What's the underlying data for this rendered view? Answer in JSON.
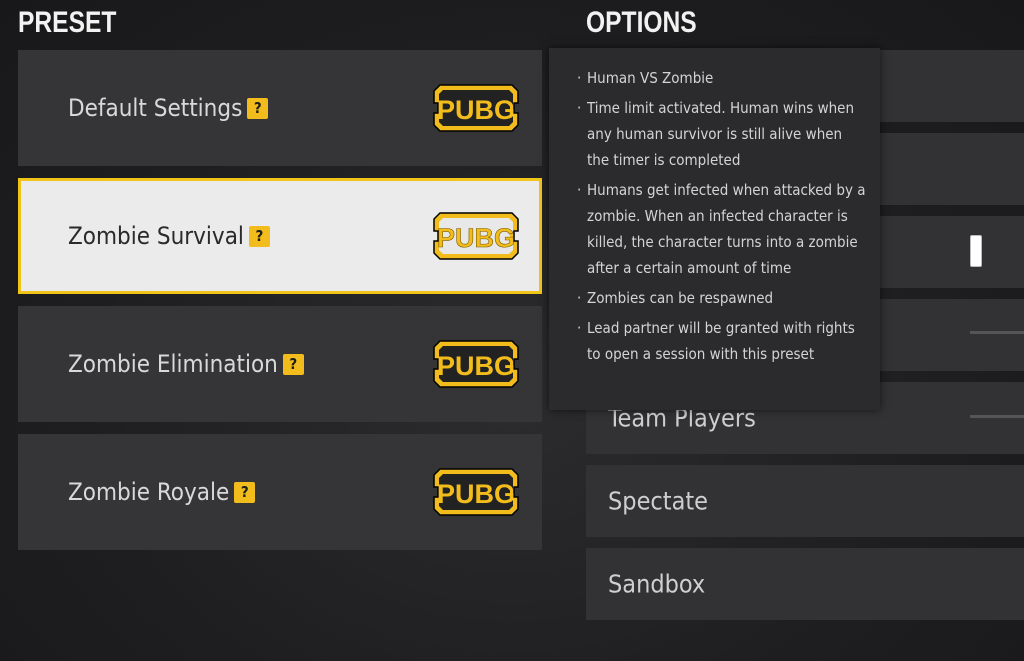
{
  "headings": {
    "preset": "PRESET",
    "options": "OPTIONS"
  },
  "presets": [
    {
      "label": "Default Settings",
      "help": "?",
      "logo": "PUBG",
      "selected": false
    },
    {
      "label": "Zombie Survival",
      "help": "?",
      "logo": "PUBG",
      "selected": true
    },
    {
      "label": "Zombie Elimination",
      "help": "?",
      "logo": "PUBG",
      "selected": false
    },
    {
      "label": "Zombie Royale",
      "help": "?",
      "logo": "PUBG",
      "selected": false
    }
  ],
  "options": [
    {
      "label": ""
    },
    {
      "label": ""
    },
    {
      "label": ""
    },
    {
      "label": ""
    },
    {
      "label": "Team Players"
    },
    {
      "label": "Spectate"
    },
    {
      "label": "Sandbox"
    }
  ],
  "tooltip": {
    "items": [
      "Human VS Zombie",
      "Time limit activated. Human wins when any human survivor is still alive when the timer is completed",
      "Humans get infected when attacked by a zombie. When an infected character is killed, the character turns into a zombie after a certain amount of time",
      "Zombies can be respawned",
      "Lead partner will be granted with rights to open a session with this preset"
    ]
  },
  "colors": {
    "accent": "#f2bd1c",
    "selected_bg": "#ebebeb",
    "card_bg": "#353537",
    "tooltip_bg": "#2b2b2e"
  }
}
